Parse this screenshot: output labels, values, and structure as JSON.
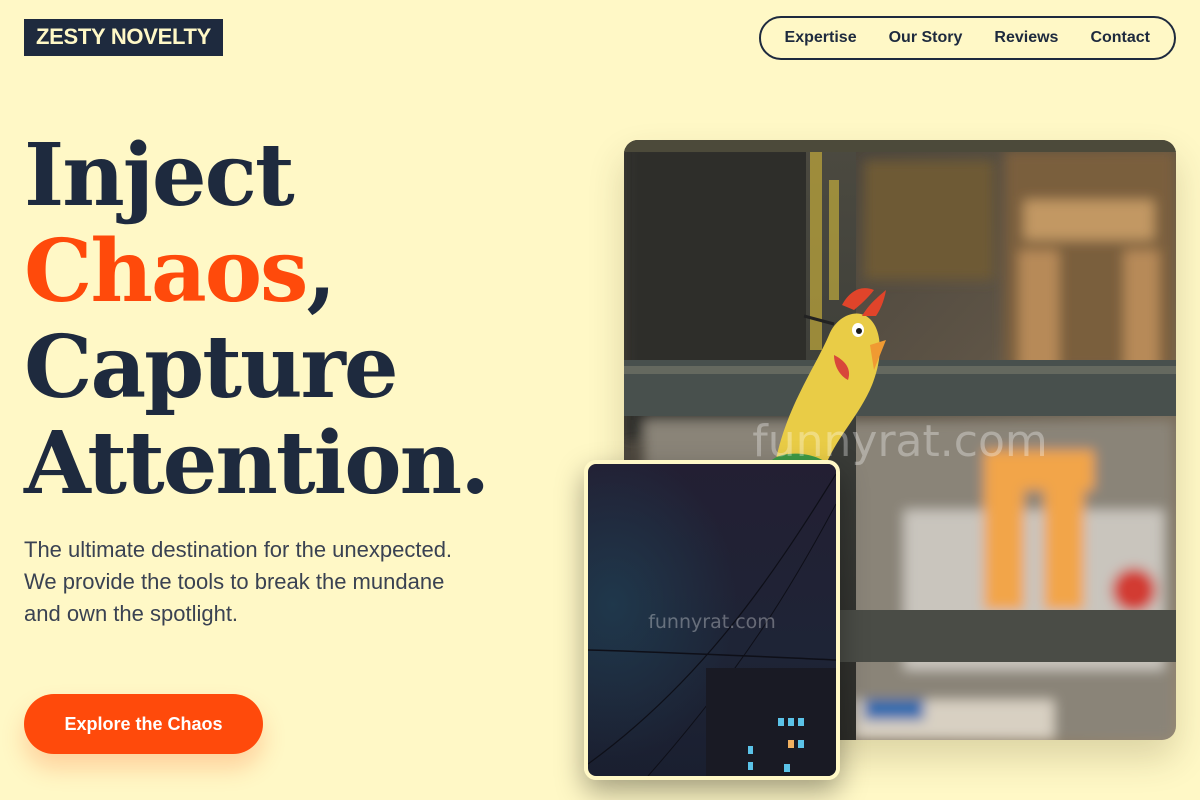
{
  "brand": {
    "logo_text": "ZESTY NOVELTY"
  },
  "nav": {
    "items": [
      {
        "label": "Expertise"
      },
      {
        "label": "Our Story"
      },
      {
        "label": "Reviews"
      },
      {
        "label": "Contact"
      }
    ]
  },
  "hero": {
    "headline": {
      "line1": "Inject",
      "line2_accent": "Chaos",
      "line2_tail": ",",
      "line3": "Capture",
      "line4": "Attention."
    },
    "description": "The ultimate destination for the unexpected. We provide the tools to break the mundane and own the spotlight.",
    "cta_label": "Explore the Chaos"
  },
  "images": {
    "main_photo": {
      "watermark": "funnyrat.com"
    },
    "small_photo": {
      "watermark": "funnyrat.com"
    }
  },
  "colors": {
    "background": "#fff8c6",
    "ink": "#1e2a3e",
    "accent": "#ff4a0b"
  }
}
